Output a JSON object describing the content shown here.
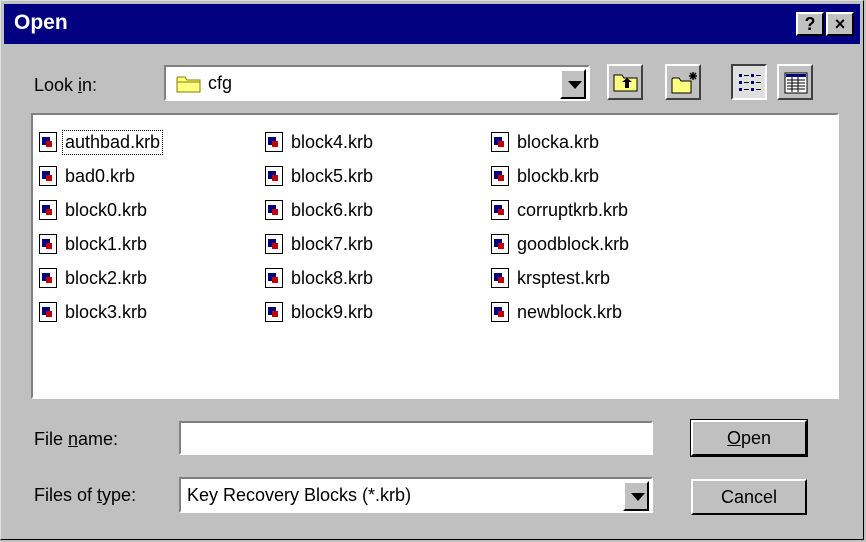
{
  "window": {
    "title": "Open",
    "help_glyph": "?",
    "close_glyph": "×"
  },
  "look_in": {
    "label_pre": "Look ",
    "label_accel": "i",
    "label_post": "n:",
    "value": "cfg"
  },
  "toolbar": {
    "up_folder_icon": "up-folder-icon",
    "new_folder_icon": "new-folder-icon",
    "list_view_icon": "list-view-icon",
    "details_view_icon": "details-view-icon"
  },
  "files": {
    "col1": [
      "authbad.krb",
      "bad0.krb",
      "block0.krb",
      "block1.krb",
      "block2.krb",
      "block3.krb"
    ],
    "col2": [
      "block4.krb",
      "block5.krb",
      "block6.krb",
      "block7.krb",
      "block8.krb",
      "block9.krb"
    ],
    "col3": [
      "blocka.krb",
      "blockb.krb",
      "corruptkrb.krb",
      "goodblock.krb",
      "krsptest.krb",
      "newblock.krb"
    ]
  },
  "filename": {
    "label_pre": "File ",
    "label_accel": "n",
    "label_post": "ame:",
    "value": ""
  },
  "filetype": {
    "label_pre": "Files of ",
    "label_accel": "t",
    "label_post": "ype:",
    "value": "Key Recovery Blocks (*.krb)"
  },
  "buttons": {
    "open_accel": "O",
    "open_rest": "pen",
    "cancel": "Cancel"
  },
  "colors": {
    "titlebar": "#000080",
    "face": "#c0c0c0"
  }
}
